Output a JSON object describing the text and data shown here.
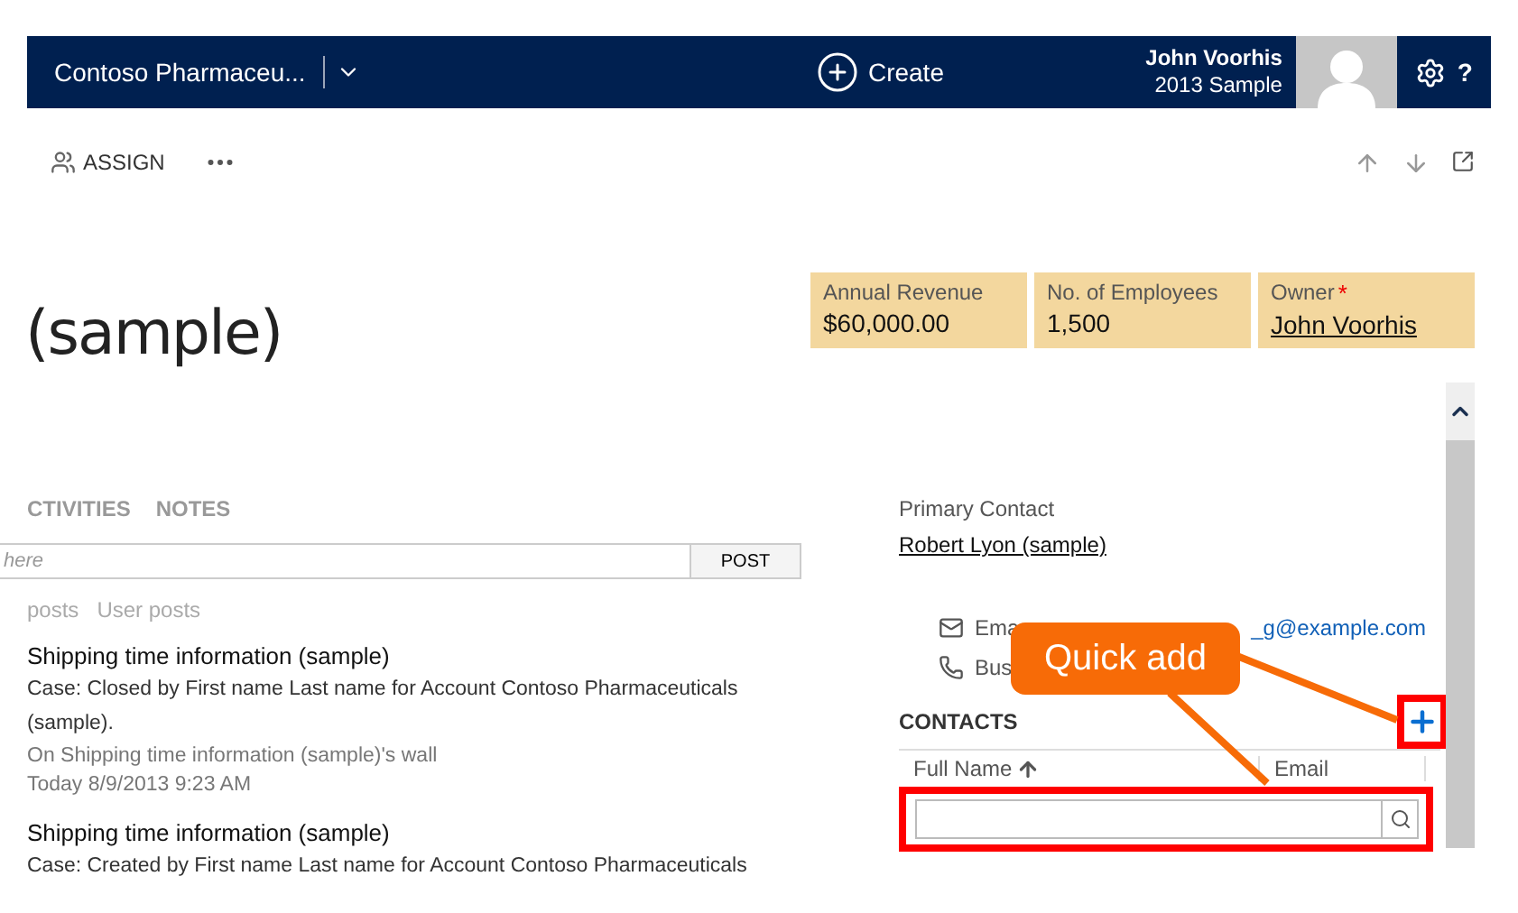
{
  "header": {
    "app_name": "Contoso Pharmaceu...",
    "create_label": "Create",
    "user_name": "John Voorhis",
    "user_org": "2013 Sample",
    "help": "?"
  },
  "toolbar": {
    "assign": "ASSIGN"
  },
  "record": {
    "title": "(sample)"
  },
  "summary_fields": [
    {
      "label": "Annual Revenue",
      "value": "$60,000.00",
      "kind": "text"
    },
    {
      "label": "No. of Employees",
      "value": "1,500",
      "kind": "text"
    },
    {
      "label": "Owner",
      "value": "John Voorhis",
      "kind": "link",
      "required_mark": "*"
    }
  ],
  "tabs": [
    {
      "label": "CTIVITIES"
    },
    {
      "label": "NOTES"
    }
  ],
  "post_box": {
    "placeholder": "here",
    "button": "POST"
  },
  "filters": [
    {
      "label": "posts"
    },
    {
      "label": "User posts"
    }
  ],
  "posts": [
    {
      "title": "Shipping time information (sample)",
      "body": "Case: Closed by First name Last name for Account Contoso Pharmaceuticals (sample).",
      "wall": "On Shipping time information (sample)'s wall",
      "time": "Today 8/9/2013 9:23 AM"
    },
    {
      "title": "Shipping time information (sample)",
      "body": "Case: Created by First name Last name for Account Contoso Pharmaceuticals"
    }
  ],
  "primary_contact": {
    "label": "Primary Contact",
    "name": "Robert Lyon (sample)",
    "email_label": "Ema",
    "email_value": "_g@example.com",
    "phone_label": "Bus"
  },
  "contacts": {
    "title": "CONTACTS",
    "columns": [
      {
        "label": "Full Name",
        "sorted": true
      },
      {
        "label": "Email",
        "sorted": false
      }
    ]
  },
  "callout": {
    "text": "Quick add"
  }
}
